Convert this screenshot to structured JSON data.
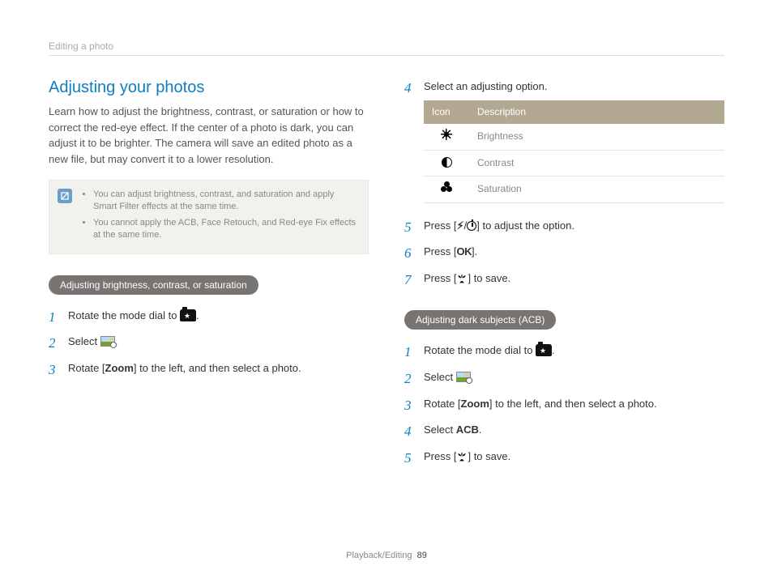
{
  "header": {
    "breadcrumb": "Editing a photo"
  },
  "section": {
    "title": "Adjusting your photos",
    "intro": "Learn how to adjust the brightness, contrast, or saturation or how to correct the red-eye effect. If the center of a photo is dark, you can adjust it to be brighter. The camera will save an edited photo as a new file, but may convert it to a lower resolution."
  },
  "note": {
    "items": [
      "You can adjust brightness, contrast, and saturation and apply Smart Filter effects at the same time.",
      "You cannot apply the ACB, Face Retouch, and Red-eye Fix effects at the same time."
    ]
  },
  "sub1": {
    "pill": "Adjusting brightness, contrast, or saturation",
    "steps": {
      "s1a": "Rotate the mode dial to ",
      "s1b": ".",
      "s2a": "Select ",
      "s2b": ".",
      "s3a": "Rotate [",
      "s3zoom": "Zoom",
      "s3b": "] to the left, and then select a photo."
    }
  },
  "right": {
    "s4": "Select an adjusting option.",
    "table": {
      "h_icon": "Icon",
      "h_desc": "Description",
      "r1": "Brightness",
      "r2": "Contrast",
      "r3": "Saturation"
    },
    "s5a": "Press [",
    "s5b": "/",
    "s5c": "] to adjust the option.",
    "s6a": "Press [",
    "s6b": "].",
    "s7a": "Press [",
    "s7b": "] to save."
  },
  "sub2": {
    "pill": "Adjusting dark subjects (ACB)",
    "steps": {
      "s1a": "Rotate the mode dial to ",
      "s1b": ".",
      "s2a": "Select ",
      "s2b": ".",
      "s3a": "Rotate [",
      "s3zoom": "Zoom",
      "s3b": "] to the left, and then select a photo.",
      "s4a": "Select ",
      "s4acb": "ACB",
      "s4b": ".",
      "s5a": "Press [",
      "s5b": "] to save."
    }
  },
  "footer": {
    "section": "Playback/Editing",
    "page": "89"
  },
  "glyph": {
    "ok": "OK"
  }
}
